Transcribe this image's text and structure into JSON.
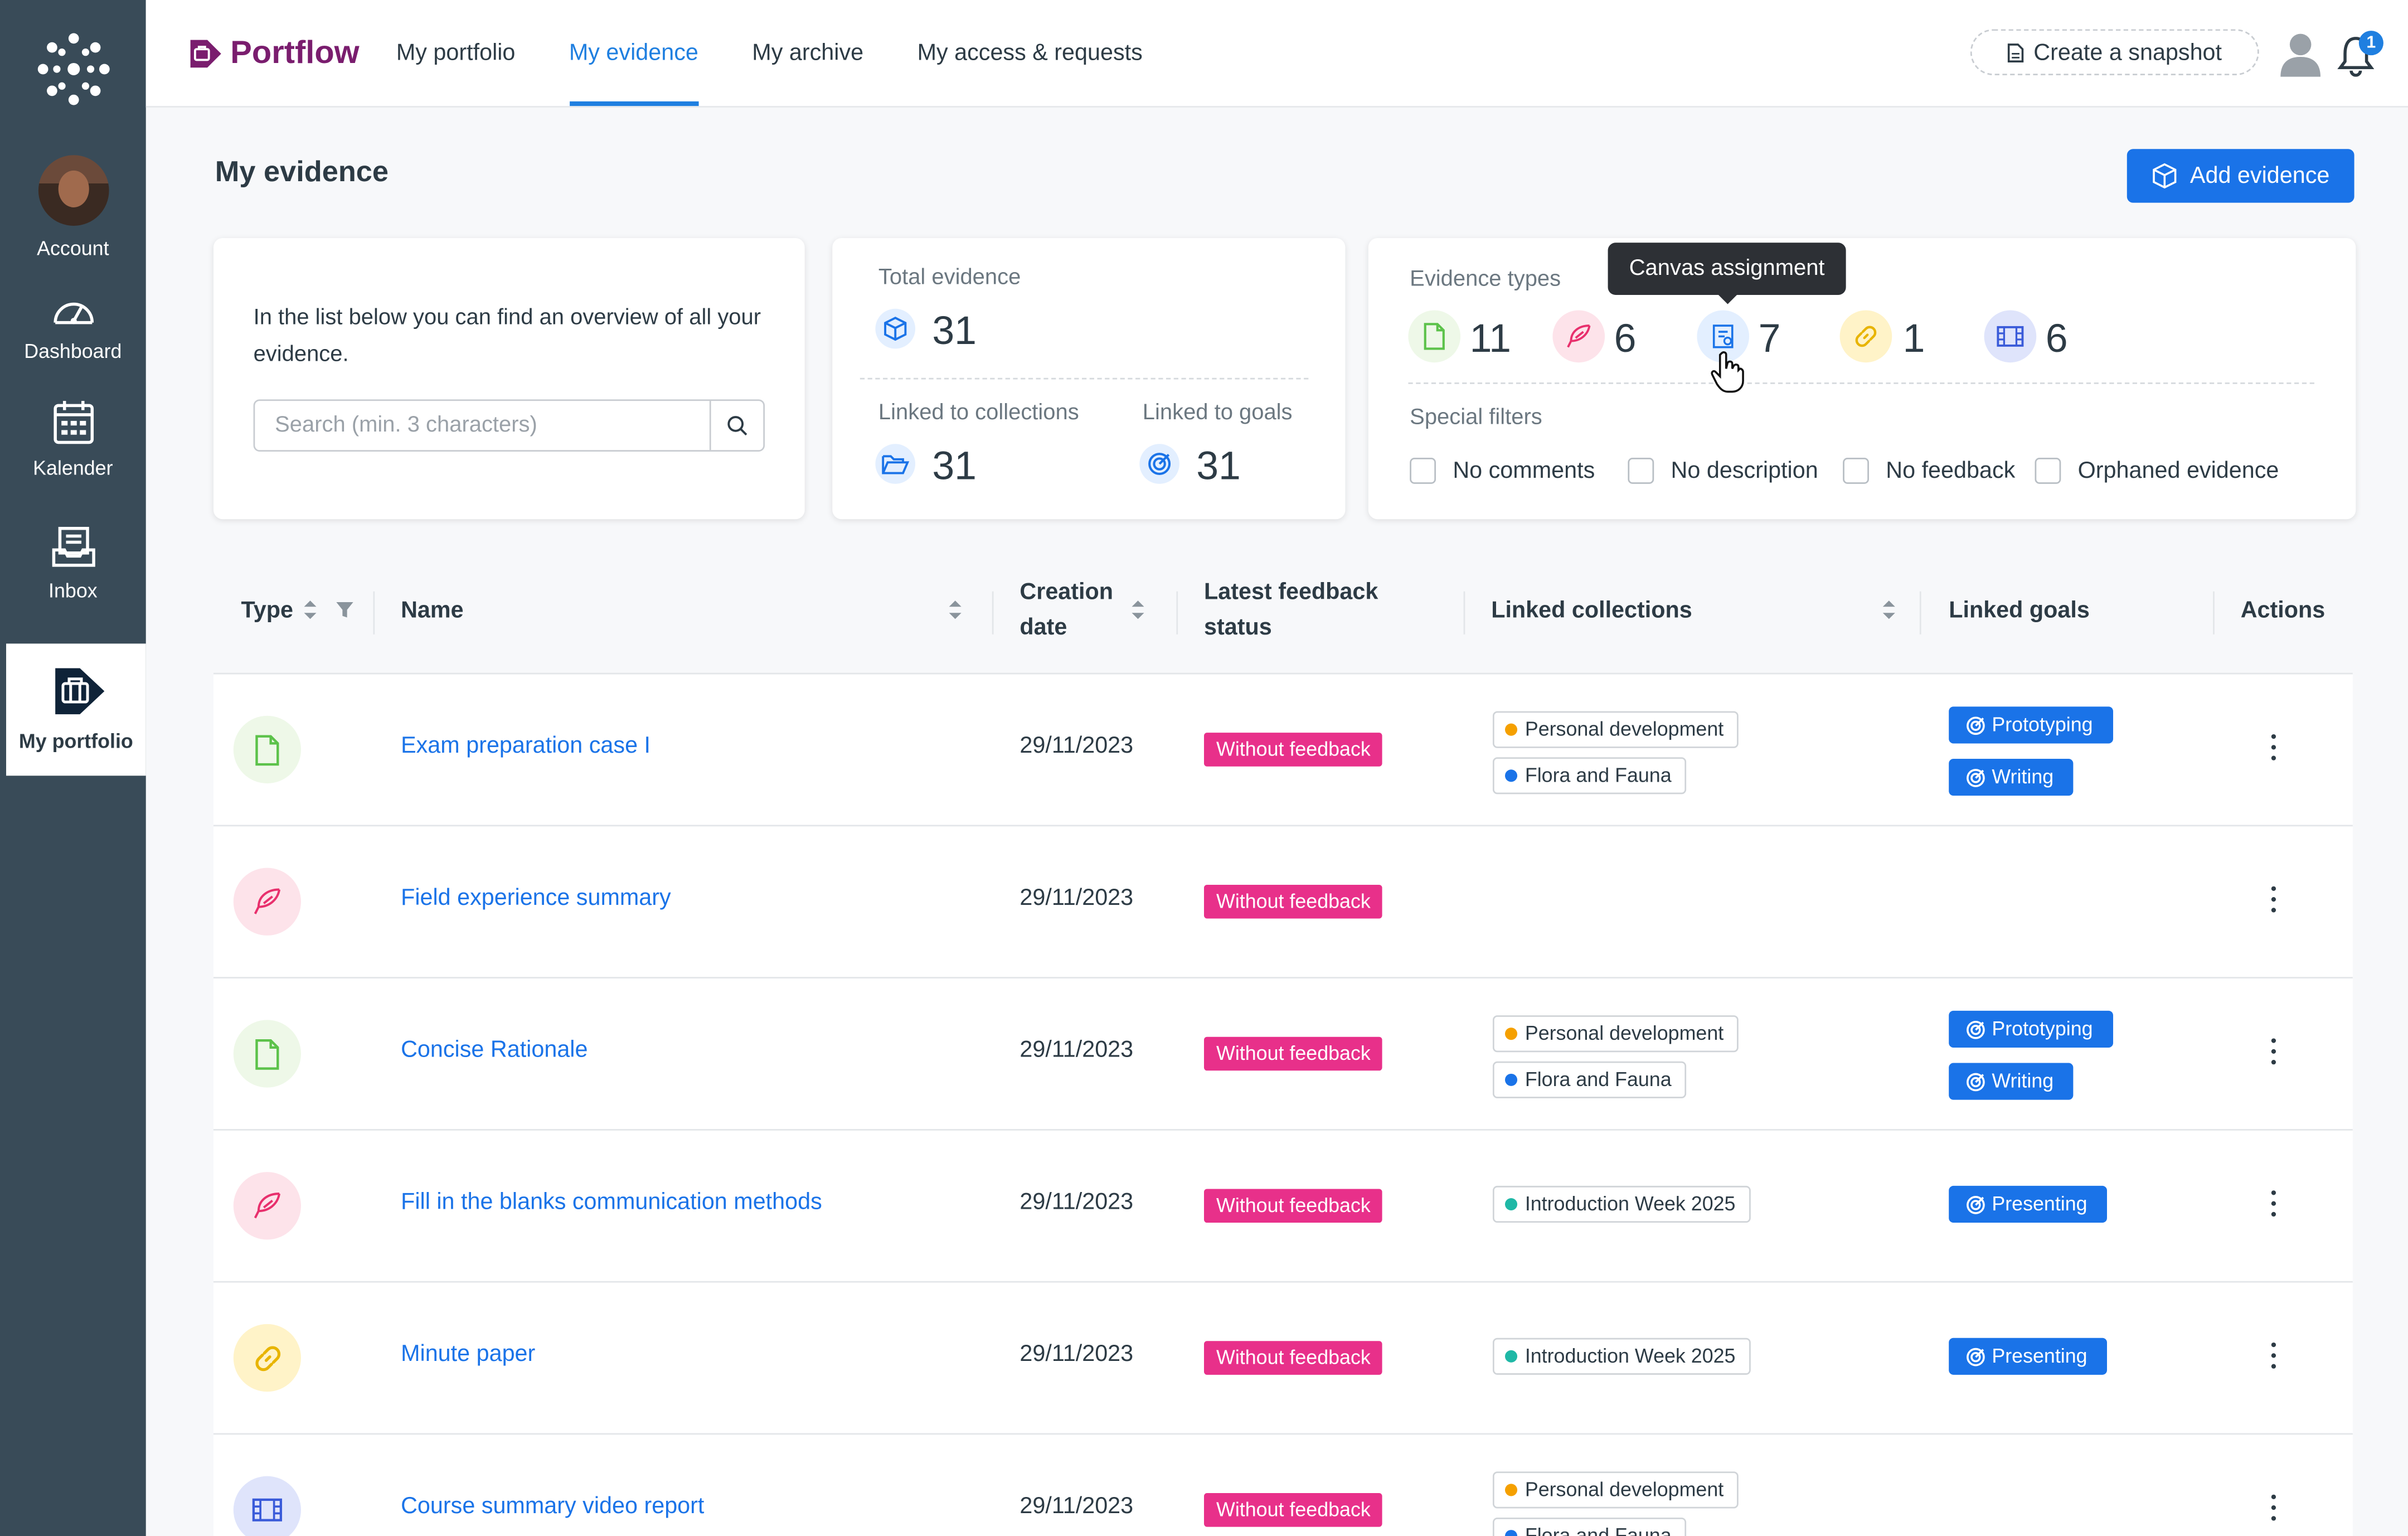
{
  "global_nav": {
    "items": [
      {
        "label": "Account",
        "icon": "avatar"
      },
      {
        "label": "Dashboard",
        "icon": "dashboard-icon"
      },
      {
        "label": "Kalender",
        "icon": "calendar-icon"
      },
      {
        "label": "Inbox",
        "icon": "inbox-icon"
      },
      {
        "label": "My portfolio",
        "icon": "portfolio-icon",
        "active": true
      }
    ]
  },
  "topbar": {
    "brand": "Portflow",
    "tabs": [
      {
        "label": "My portfolio"
      },
      {
        "label": "My evidence",
        "active": true
      },
      {
        "label": "My archive"
      },
      {
        "label": "My access & requests"
      }
    ],
    "snapshot_label": "Create a snapshot",
    "notification_count": "1"
  },
  "page": {
    "title": "My evidence",
    "add_button": "Add evidence"
  },
  "intro": {
    "text": "In the list below you can find an overview of all your evidence.",
    "search_placeholder": "Search (min. 3 characters)"
  },
  "stats": {
    "total_label": "Total evidence",
    "total_value": "31",
    "collections_label": "Linked to collections",
    "collections_value": "31",
    "goals_label": "Linked to goals",
    "goals_value": "31"
  },
  "types": {
    "title": "Evidence types",
    "items": [
      {
        "icon": "file-icon",
        "count": "11",
        "color": "#5cc24a"
      },
      {
        "icon": "feather-icon",
        "count": "6",
        "color": "#e8306d"
      },
      {
        "icon": "canvas-assignment-icon",
        "count": "7",
        "color": "#1a73e8"
      },
      {
        "icon": "link-icon",
        "count": "1",
        "color": "#e8b400"
      },
      {
        "icon": "film-icon",
        "count": "6",
        "color": "#3a5bd9"
      }
    ],
    "tooltip": "Canvas assignment",
    "special_filters_title": "Special filters",
    "filters": [
      "No comments",
      "No description",
      "No feedback",
      "Orphaned evidence"
    ]
  },
  "table": {
    "headers": {
      "type": "Type",
      "name": "Name",
      "creation_date_1": "Creation",
      "creation_date_2": "date",
      "feedback_1": "Latest feedback",
      "feedback_2": "status",
      "collections": "Linked collections",
      "goals": "Linked goals",
      "actions": "Actions"
    },
    "rows": [
      {
        "type": "file",
        "name": "Exam preparation case I",
        "date": "29/11/2023",
        "feedback": "Without feedback",
        "collections": [
          {
            "label": "Personal development",
            "color": "#f5a000"
          },
          {
            "label": "Flora and Fauna",
            "color": "#1a73e8"
          }
        ],
        "goals": [
          "Prototyping",
          "Writing"
        ]
      },
      {
        "type": "feather",
        "name": "Field experience summary",
        "date": "29/11/2023",
        "feedback": "Without feedback",
        "collections": [],
        "goals": []
      },
      {
        "type": "file",
        "name": "Concise Rationale",
        "date": "29/11/2023",
        "feedback": "Without feedback",
        "collections": [
          {
            "label": "Personal development",
            "color": "#f5a000"
          },
          {
            "label": "Flora and Fauna",
            "color": "#1a73e8"
          }
        ],
        "goals": [
          "Prototyping",
          "Writing"
        ]
      },
      {
        "type": "feather",
        "name": "Fill in the blanks communication methods",
        "date": "29/11/2023",
        "feedback": "Without feedback",
        "collections": [
          {
            "label": "Introduction Week 2025",
            "color": "#1fb8a6"
          }
        ],
        "goals": [
          "Presenting"
        ]
      },
      {
        "type": "link",
        "name": "Minute paper",
        "date": "29/11/2023",
        "feedback": "Without feedback",
        "collections": [
          {
            "label": "Introduction Week 2025",
            "color": "#1fb8a6"
          }
        ],
        "goals": [
          "Presenting"
        ]
      },
      {
        "type": "film",
        "name": "Course summary video report",
        "date": "29/11/2023",
        "feedback": "Without feedback",
        "collections": [
          {
            "label": "Personal development",
            "color": "#f5a000"
          },
          {
            "label": "Flora and Fauna",
            "color": "#1a73e8"
          }
        ],
        "goals": []
      }
    ]
  }
}
